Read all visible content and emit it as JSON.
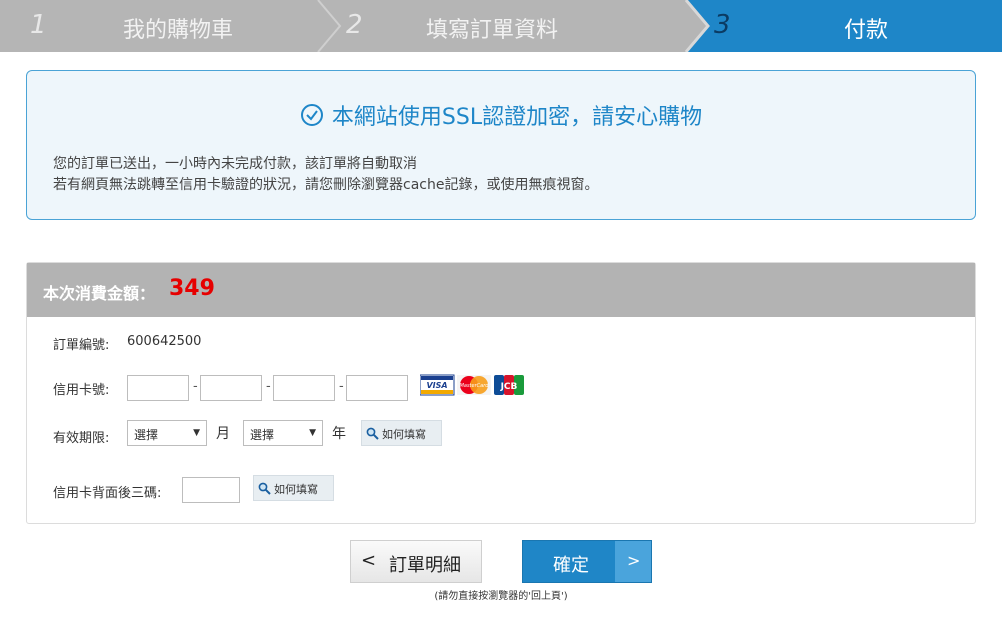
{
  "steps": [
    {
      "number": "1",
      "label": "我的購物車"
    },
    {
      "number": "2",
      "label": "填寫訂單資料"
    },
    {
      "number": "3",
      "label": "付款"
    }
  ],
  "colors": {
    "active_step": "#1e86c8",
    "inactive_step": "#b3b3b3",
    "amount": "#e60000",
    "accent": "#1f86c7"
  },
  "notice": {
    "title": "本網站使用SSL認證加密，請安心購物",
    "line1": "您的訂單已送出，一小時內未完成付款，該訂單將自動取消",
    "line2": "若有網頁無法跳轉至信用卡驗證的狀況，請您刪除瀏覽器cache記錄，或使用無痕視窗。"
  },
  "payment": {
    "amount_label": "本次消費金額：",
    "amount_value": "349",
    "order_no_label": "訂單編號:",
    "order_no_value": "600642500",
    "card_no_label": "信用卡號:",
    "card_logos": [
      "VISA",
      "MasterCard",
      "JCB"
    ],
    "expiry_label": "有效期限:",
    "month_select": "選擇",
    "month_unit": "月",
    "year_select": "選擇",
    "year_unit": "年",
    "help_label": "如何填寫",
    "cvv_label": "信用卡背面後三碼:"
  },
  "buttons": {
    "back_arrow": "<",
    "back_label": "訂單明細",
    "confirm_label": "確定",
    "confirm_arrow": ">"
  },
  "footer_note": "(請勿直接按瀏覽器的'回上頁')"
}
